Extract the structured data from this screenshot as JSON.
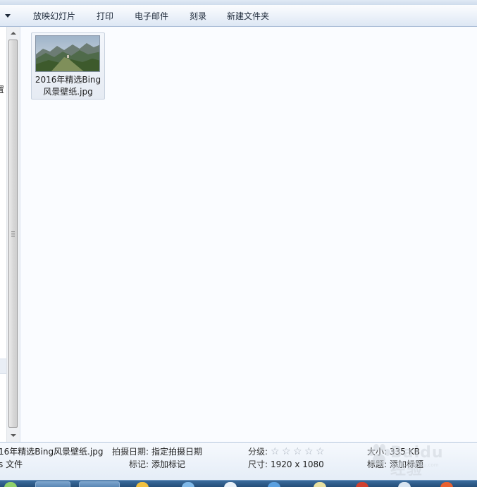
{
  "toolbar": {
    "items": [
      "放映幻灯片",
      "打印",
      "电子邮件",
      "刻录",
      "新建文件夹"
    ]
  },
  "left_pane": {
    "fragment": "置"
  },
  "file": {
    "name_line1": "2016年精选Bing",
    "name_line2": "风景壁纸.jpg"
  },
  "details": {
    "filename": "16年精选Bing风景壁纸.jpg",
    "type_fragment": "s 文件",
    "date_label": "拍摄日期:",
    "date_value": "指定拍摄日期",
    "tags_label": "标记:",
    "tags_value": "添加标记",
    "rating_label": "分级:",
    "rating_value": 0,
    "rating_max": 5,
    "dim_label": "尺寸:",
    "dim_value": "1920 x 1080",
    "size_label": "大小:",
    "size_value": "335 KB",
    "title_label": "标题:",
    "title_value": "添加标题"
  },
  "watermark": {
    "text": "Baidu经验",
    "sub": "jingyan.baidu.com"
  },
  "colors": {
    "accent": "#3a6b9c",
    "toolbar_border": "#a9bcd6",
    "content_bg": "#fafcff"
  }
}
